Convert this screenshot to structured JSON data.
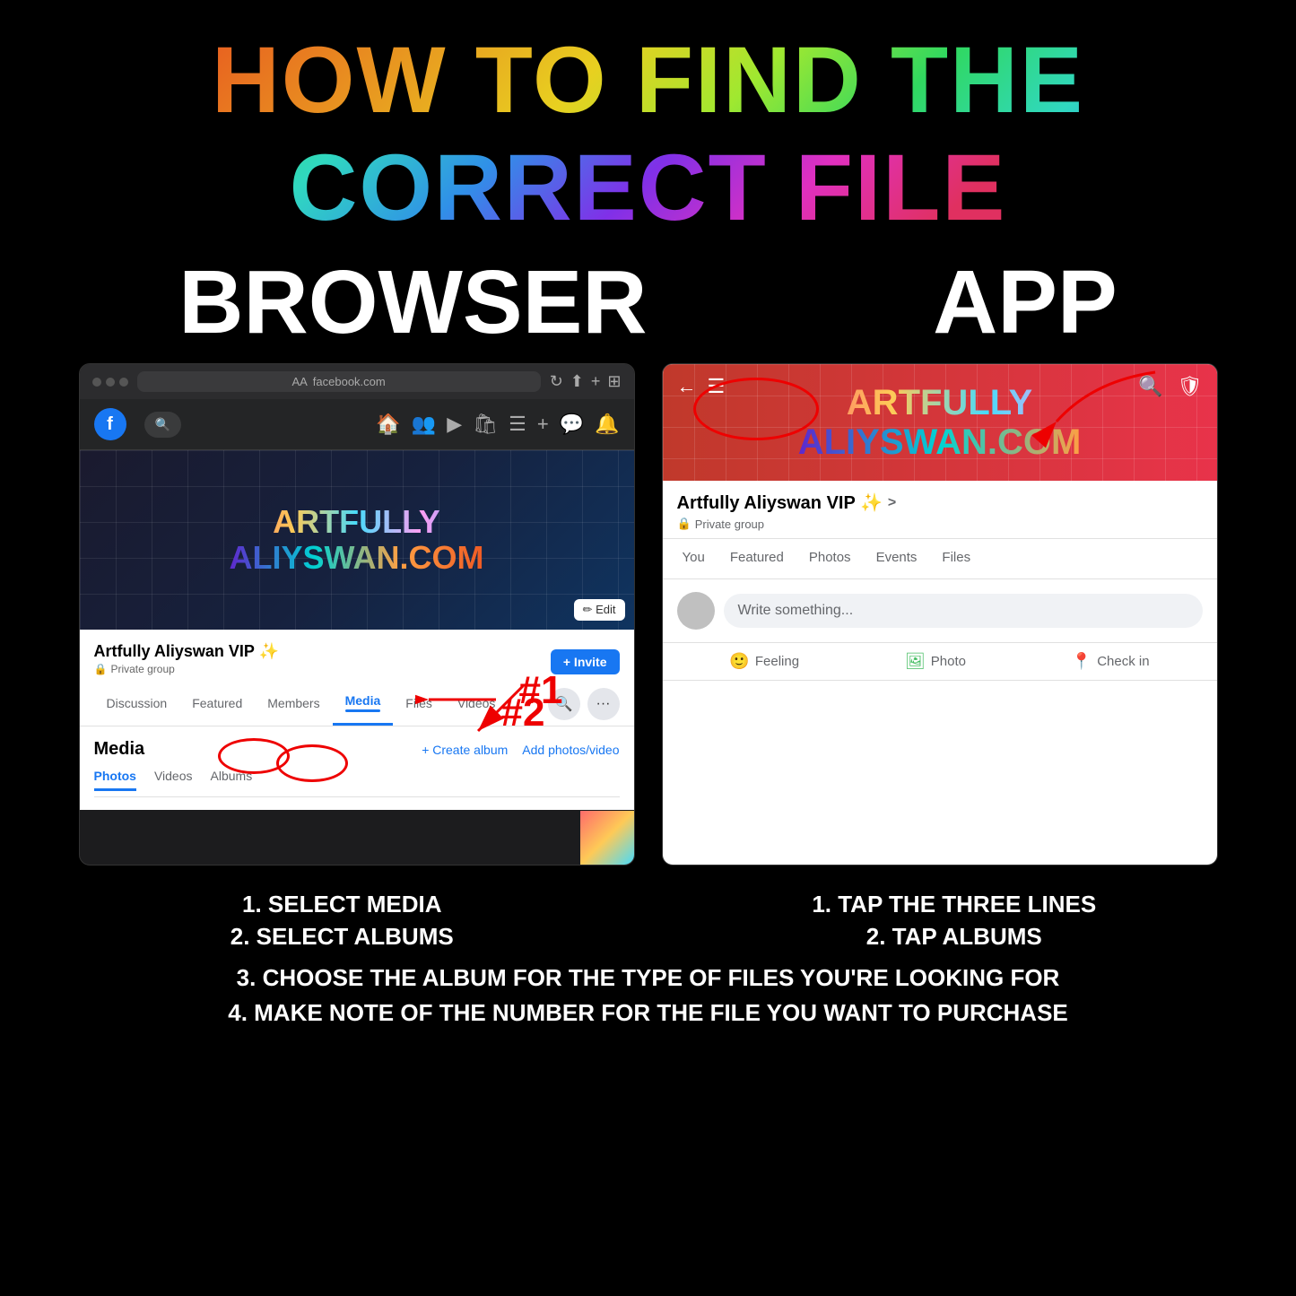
{
  "title": "HOW TO FIND THE CORRECT FILE",
  "browser_label": "BROWSER",
  "app_label": "APP",
  "brand_line1": "ARTFULLY",
  "brand_line2": "ALIYSWAN.COM",
  "browser": {
    "url": "facebook.com",
    "aa_label": "AA",
    "group_title": "Artfully Aliyswan VIP ✨",
    "private_label": "Private group",
    "invite_btn": "+ Invite",
    "edit_btn": "✏ Edit",
    "tabs": [
      "Discussion",
      "Featured",
      "Members",
      "Media",
      "Files",
      "Videos"
    ],
    "active_tab": "Media",
    "media_title": "Media",
    "create_album": "+ Create album",
    "add_photos": "Add photos/video",
    "media_subtabs": [
      "Photos",
      "Videos",
      "Albums"
    ],
    "active_subtab": "Photos",
    "annotation_1": "#1",
    "annotation_2": "#2"
  },
  "app": {
    "group_title": "Artfully Aliyswan VIP ✨",
    "chevron": ">",
    "private_label": "Private group",
    "tabs": [
      "You",
      "Featured",
      "Photos",
      "Events",
      "Files"
    ],
    "post_placeholder": "Write something...",
    "feeling_label": "Feeling",
    "photo_label": "Photo",
    "checkin_label": "Check in"
  },
  "instructions": {
    "browser_1": "1. SELECT MEDIA",
    "browser_2": "2. SELECT ALBUMS",
    "app_1": "1. TAP THE THREE LINES",
    "app_2": "2. TAP ALBUMS",
    "shared_3": "3. CHOOSE THE ALBUM FOR THE TYPE OF FILES YOU'RE LOOKING FOR",
    "shared_4": "4. MAKE NOTE OF THE NUMBER FOR THE FILE YOU WANT TO PURCHASE"
  }
}
